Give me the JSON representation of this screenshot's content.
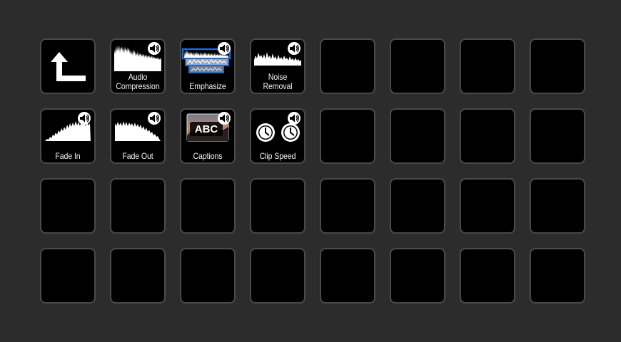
{
  "deck": {
    "keys": [
      {
        "label": "",
        "icon": "back-arrow-icon"
      },
      {
        "label": "Audio\nCompression",
        "icon": "audio-compression-waveform-icon"
      },
      {
        "label": "Emphasize",
        "icon": "emphasize-waveform-icon"
      },
      {
        "label": "Noise\nRemoval",
        "icon": "noise-removal-waveform-icon"
      },
      {
        "label": "Fade In",
        "icon": "fade-in-waveform-icon"
      },
      {
        "label": "Fade Out",
        "icon": "fade-out-waveform-icon"
      },
      {
        "label": "Captions",
        "icon": "captions-icon",
        "icon_text": "ABC"
      },
      {
        "label": "Clip Speed",
        "icon": "clip-speed-clocks-icon"
      }
    ],
    "columns": 8,
    "rows": 4
  },
  "colors": {
    "background": "#2c2c2c",
    "key": "#000000",
    "key_border": "#4a4a4a",
    "highlight": "#1e6bd6",
    "icon": "#ffffff"
  }
}
